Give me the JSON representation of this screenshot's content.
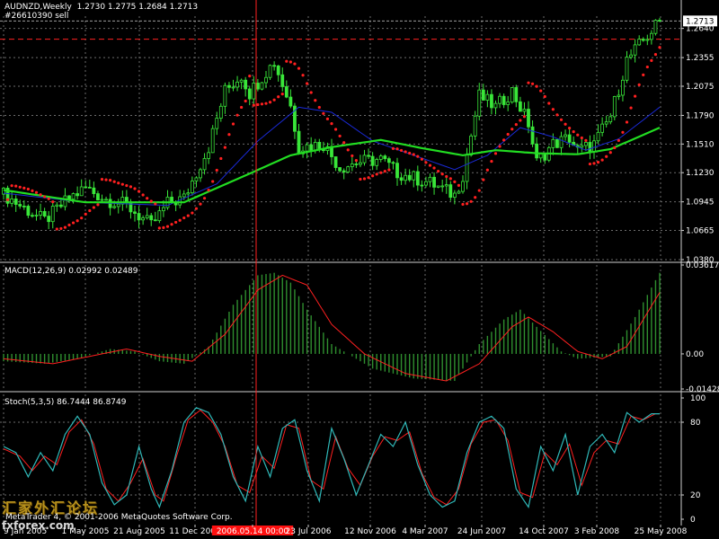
{
  "header": {
    "symbol_line": "AUDNZD,Weekly  1.2730 1.2775 1.2684 1.2713",
    "order_line": "#26610390 sell"
  },
  "colors": {
    "background": "#000000",
    "grid": "#6b6b6b",
    "bull_candle": "#39e639",
    "bear_candle": "#39e639",
    "parabolic_sar": "#ff2020",
    "ma_slow": "#22dd22",
    "ma_fast": "#1a2ad8",
    "macd_hist": "#2f8f2f",
    "macd_signal": "#ff2020",
    "stoch_main": "#2fb8b8",
    "stoch_signal": "#ff2020",
    "vline": "#ff2020",
    "level_line": "#ff2020",
    "price_line": "#9b9b9b",
    "axis_text": "#ffffff",
    "highlight_label_bg": "#ff1010"
  },
  "chart_data": [
    {
      "type": "candlestick",
      "title": "AUDNZD,Weekly",
      "ohlc_header": "1.2730 1.2775 1.2684 1.2713",
      "current_price": 1.2713,
      "current_price_label": "1.2713",
      "order_level": 1.2535,
      "ylim": [
        1.038,
        1.276
      ],
      "y_ticks": [
        "1.2640",
        "1.2355",
        "1.2075",
        "1.1790",
        "1.1510",
        "1.1230",
        "1.0945",
        "1.0665",
        "1.0380"
      ],
      "x_ticks": [
        "9 Jan 2005",
        "1 May 2005",
        "21 Aug 2005",
        "11 Dec 2005",
        "2006.05.14 00:00",
        "23 Jul 2006",
        "12 Nov 2006",
        "4 Mar 2007",
        "24 Jun 2007",
        "14 Oct 2007",
        "3 Feb 2008",
        "25 May 2008"
      ],
      "highlighted_x_tick": "2006.05.14 00:00",
      "close_trend_keypoints": [
        [
          0,
          1.102
        ],
        [
          4,
          1.091
        ],
        [
          10,
          1.076
        ],
        [
          16,
          1.098
        ],
        [
          20,
          1.108
        ],
        [
          25,
          1.097
        ],
        [
          30,
          1.091
        ],
        [
          36,
          1.071
        ],
        [
          40,
          1.093
        ],
        [
          44,
          1.098
        ],
        [
          50,
          1.148
        ],
        [
          54,
          1.203
        ],
        [
          58,
          1.218
        ],
        [
          60,
          1.201
        ],
        [
          64,
          1.222
        ],
        [
          66,
          1.231
        ],
        [
          70,
          1.188
        ],
        [
          72,
          1.148
        ],
        [
          78,
          1.151
        ],
        [
          82,
          1.128
        ],
        [
          86,
          1.133
        ],
        [
          92,
          1.136
        ],
        [
          96,
          1.123
        ],
        [
          104,
          1.113
        ],
        [
          110,
          1.101
        ],
        [
          112,
          1.121
        ],
        [
          116,
          1.198
        ],
        [
          120,
          1.187
        ],
        [
          124,
          1.203
        ],
        [
          128,
          1.171
        ],
        [
          130,
          1.133
        ],
        [
          134,
          1.151
        ],
        [
          138,
          1.157
        ],
        [
          140,
          1.144
        ],
        [
          144,
          1.151
        ],
        [
          148,
          1.178
        ],
        [
          152,
          1.233
        ],
        [
          156,
          1.252
        ],
        [
          160,
          1.271
        ]
      ],
      "ma_slow_keypoints": [
        [
          0,
          1.106
        ],
        [
          20,
          1.094
        ],
        [
          44,
          1.094
        ],
        [
          56,
          1.115
        ],
        [
          70,
          1.14
        ],
        [
          80,
          1.148
        ],
        [
          92,
          1.155
        ],
        [
          102,
          1.147
        ],
        [
          112,
          1.14
        ],
        [
          120,
          1.145
        ],
        [
          130,
          1.142
        ],
        [
          140,
          1.141
        ],
        [
          148,
          1.146
        ],
        [
          160,
          1.167
        ]
      ],
      "ma_fast_keypoints": [
        [
          0,
          1.103
        ],
        [
          20,
          1.094
        ],
        [
          40,
          1.091
        ],
        [
          52,
          1.112
        ],
        [
          62,
          1.154
        ],
        [
          72,
          1.187
        ],
        [
          80,
          1.182
        ],
        [
          90,
          1.154
        ],
        [
          100,
          1.14
        ],
        [
          110,
          1.126
        ],
        [
          118,
          1.14
        ],
        [
          126,
          1.167
        ],
        [
          134,
          1.158
        ],
        [
          142,
          1.145
        ],
        [
          150,
          1.156
        ],
        [
          160,
          1.187
        ]
      ],
      "series": [
        {
          "name": "Price"
        },
        {
          "name": "Parabolic SAR"
        },
        {
          "name": "Moving Average (slow)"
        },
        {
          "name": "Moving Average (fast)"
        }
      ]
    },
    {
      "type": "bar",
      "title": "MACD(12,26,9) 0.02992 0.02489",
      "ylim": [
        -0.01428,
        0.03617
      ],
      "y_ticks": [
        "0.03617",
        "0.00",
        "-0.01428"
      ],
      "macd_keypoints": [
        [
          0,
          -0.003
        ],
        [
          10,
          -0.004
        ],
        [
          18,
          -0.002
        ],
        [
          26,
          0.002
        ],
        [
          32,
          0.001
        ],
        [
          38,
          -0.003
        ],
        [
          44,
          -0.004
        ],
        [
          50,
          0.003
        ],
        [
          56,
          0.02
        ],
        [
          62,
          0.032
        ],
        [
          66,
          0.033
        ],
        [
          70,
          0.029
        ],
        [
          74,
          0.018
        ],
        [
          80,
          0.004
        ],
        [
          90,
          -0.006
        ],
        [
          100,
          -0.01
        ],
        [
          110,
          -0.011
        ],
        [
          116,
          0.004
        ],
        [
          122,
          0.014
        ],
        [
          126,
          0.018
        ],
        [
          130,
          0.011
        ],
        [
          136,
          0.001
        ],
        [
          140,
          -0.002
        ],
        [
          148,
          -0.001
        ],
        [
          154,
          0.015
        ],
        [
          160,
          0.033
        ]
      ],
      "signal_keypoints": [
        [
          0,
          -0.002
        ],
        [
          12,
          -0.004
        ],
        [
          24,
          0.0
        ],
        [
          30,
          0.002
        ],
        [
          38,
          -0.001
        ],
        [
          46,
          -0.003
        ],
        [
          54,
          0.008
        ],
        [
          62,
          0.026
        ],
        [
          68,
          0.032
        ],
        [
          74,
          0.028
        ],
        [
          80,
          0.012
        ],
        [
          88,
          0.0
        ],
        [
          98,
          -0.008
        ],
        [
          108,
          -0.011
        ],
        [
          116,
          -0.004
        ],
        [
          124,
          0.011
        ],
        [
          128,
          0.015
        ],
        [
          134,
          0.009
        ],
        [
          140,
          0.001
        ],
        [
          146,
          -0.002
        ],
        [
          152,
          0.003
        ],
        [
          160,
          0.025
        ]
      ]
    },
    {
      "type": "line",
      "title": "Stoch(5,3,5) 86.7444 86.8749",
      "ylim": [
        0,
        100
      ],
      "y_ticks": [
        "100",
        "80",
        "20",
        "0"
      ],
      "main_keypoints": [
        [
          0,
          60
        ],
        [
          3,
          55
        ],
        [
          6,
          35
        ],
        [
          9,
          55
        ],
        [
          12,
          40
        ],
        [
          15,
          70
        ],
        [
          18,
          85
        ],
        [
          21,
          70
        ],
        [
          24,
          30
        ],
        [
          27,
          12
        ],
        [
          30,
          20
        ],
        [
          33,
          60
        ],
        [
          36,
          25
        ],
        [
          38,
          10
        ],
        [
          41,
          40
        ],
        [
          44,
          80
        ],
        [
          47,
          92
        ],
        [
          50,
          88
        ],
        [
          53,
          70
        ],
        [
          56,
          35
        ],
        [
          59,
          15
        ],
        [
          62,
          60
        ],
        [
          65,
          35
        ],
        [
          68,
          75
        ],
        [
          71,
          82
        ],
        [
          74,
          40
        ],
        [
          77,
          15
        ],
        [
          80,
          75
        ],
        [
          83,
          50
        ],
        [
          86,
          20
        ],
        [
          89,
          45
        ],
        [
          92,
          70
        ],
        [
          95,
          60
        ],
        [
          98,
          80
        ],
        [
          101,
          45
        ],
        [
          104,
          20
        ],
        [
          107,
          10
        ],
        [
          110,
          15
        ],
        [
          113,
          55
        ],
        [
          116,
          80
        ],
        [
          119,
          85
        ],
        [
          122,
          75
        ],
        [
          125,
          25
        ],
        [
          128,
          10
        ],
        [
          131,
          60
        ],
        [
          134,
          40
        ],
        [
          137,
          70
        ],
        [
          140,
          20
        ],
        [
          143,
          60
        ],
        [
          146,
          70
        ],
        [
          149,
          55
        ],
        [
          152,
          88
        ],
        [
          155,
          80
        ],
        [
          158,
          87
        ],
        [
          160,
          87
        ]
      ],
      "signal_keypoints": [
        [
          0,
          58
        ],
        [
          4,
          52
        ],
        [
          7,
          40
        ],
        [
          10,
          52
        ],
        [
          13,
          45
        ],
        [
          16,
          72
        ],
        [
          19,
          82
        ],
        [
          22,
          62
        ],
        [
          25,
          25
        ],
        [
          28,
          15
        ],
        [
          31,
          30
        ],
        [
          34,
          50
        ],
        [
          37,
          20
        ],
        [
          39,
          15
        ],
        [
          42,
          50
        ],
        [
          45,
          82
        ],
        [
          48,
          90
        ],
        [
          51,
          80
        ],
        [
          54,
          60
        ],
        [
          57,
          28
        ],
        [
          60,
          22
        ],
        [
          63,
          52
        ],
        [
          66,
          42
        ],
        [
          69,
          78
        ],
        [
          72,
          75
        ],
        [
          75,
          32
        ],
        [
          78,
          25
        ],
        [
          81,
          68
        ],
        [
          84,
          42
        ],
        [
          87,
          28
        ],
        [
          90,
          52
        ],
        [
          93,
          68
        ],
        [
          96,
          65
        ],
        [
          99,
          72
        ],
        [
          102,
          38
        ],
        [
          105,
          18
        ],
        [
          108,
          12
        ],
        [
          111,
          25
        ],
        [
          114,
          62
        ],
        [
          117,
          80
        ],
        [
          120,
          82
        ],
        [
          123,
          65
        ],
        [
          126,
          22
        ],
        [
          129,
          18
        ],
        [
          132,
          55
        ],
        [
          135,
          45
        ],
        [
          138,
          62
        ],
        [
          141,
          28
        ],
        [
          144,
          55
        ],
        [
          147,
          65
        ],
        [
          150,
          62
        ],
        [
          153,
          85
        ],
        [
          156,
          82
        ],
        [
          159,
          87
        ],
        [
          160,
          87
        ]
      ]
    }
  ],
  "footer": {
    "copyright": "MetaTrader 4, © 2001-2006 MetaQuotes Software Corp.",
    "logo_text": "汇家外汇论坛",
    "logo_sub": "fxforex.com"
  }
}
